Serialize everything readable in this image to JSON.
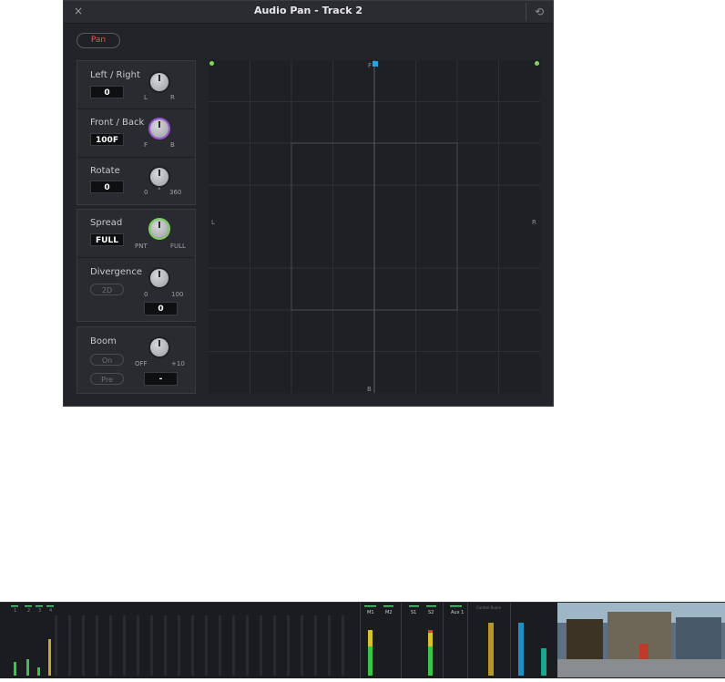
{
  "window": {
    "title": "Audio Pan - Track 2",
    "close_glyph": "×",
    "reset_glyph": "⟲"
  },
  "mode_button": "Pan",
  "controls": {
    "left_right": {
      "label": "Left / Right",
      "value": "0",
      "min_label": "L",
      "max_label": "R"
    },
    "front_back": {
      "label": "Front / Back",
      "value": "100F",
      "min_label": "F",
      "max_label": "B"
    },
    "rotate": {
      "label": "Rotate",
      "value": "0",
      "min_label": "0",
      "unit": "°",
      "max_label": "360"
    },
    "spread": {
      "label": "Spread",
      "value": "FULL",
      "min_label": "PNT",
      "max_label": "FULL"
    },
    "divergence": {
      "label": "Divergence",
      "mode_button": "2D",
      "min_label": "0",
      "max_label": "100",
      "value": "0"
    },
    "boom": {
      "label": "Boom",
      "on_button": "On",
      "pre_button": "Pre",
      "min_label": "OFF",
      "max_label": "+10",
      "value": "-"
    }
  },
  "pan_grid": {
    "front_label": "F",
    "back_label": "B",
    "left_label": "L",
    "right_label": "R"
  },
  "mixer": {
    "channel_numbers": [
      "1",
      "2",
      "3",
      "4"
    ],
    "bus_labels": [
      "M1",
      "M2",
      "S1",
      "S2",
      "Aux 1"
    ],
    "control_room_label": "Control Room"
  },
  "colors": {
    "accent_red": "#ff4b4b",
    "speaker_green": "#7ed957",
    "puck_blue": "#1ea5e8",
    "front_back_knob": "#9a56d6",
    "spread_knob": "#7dd35a"
  }
}
